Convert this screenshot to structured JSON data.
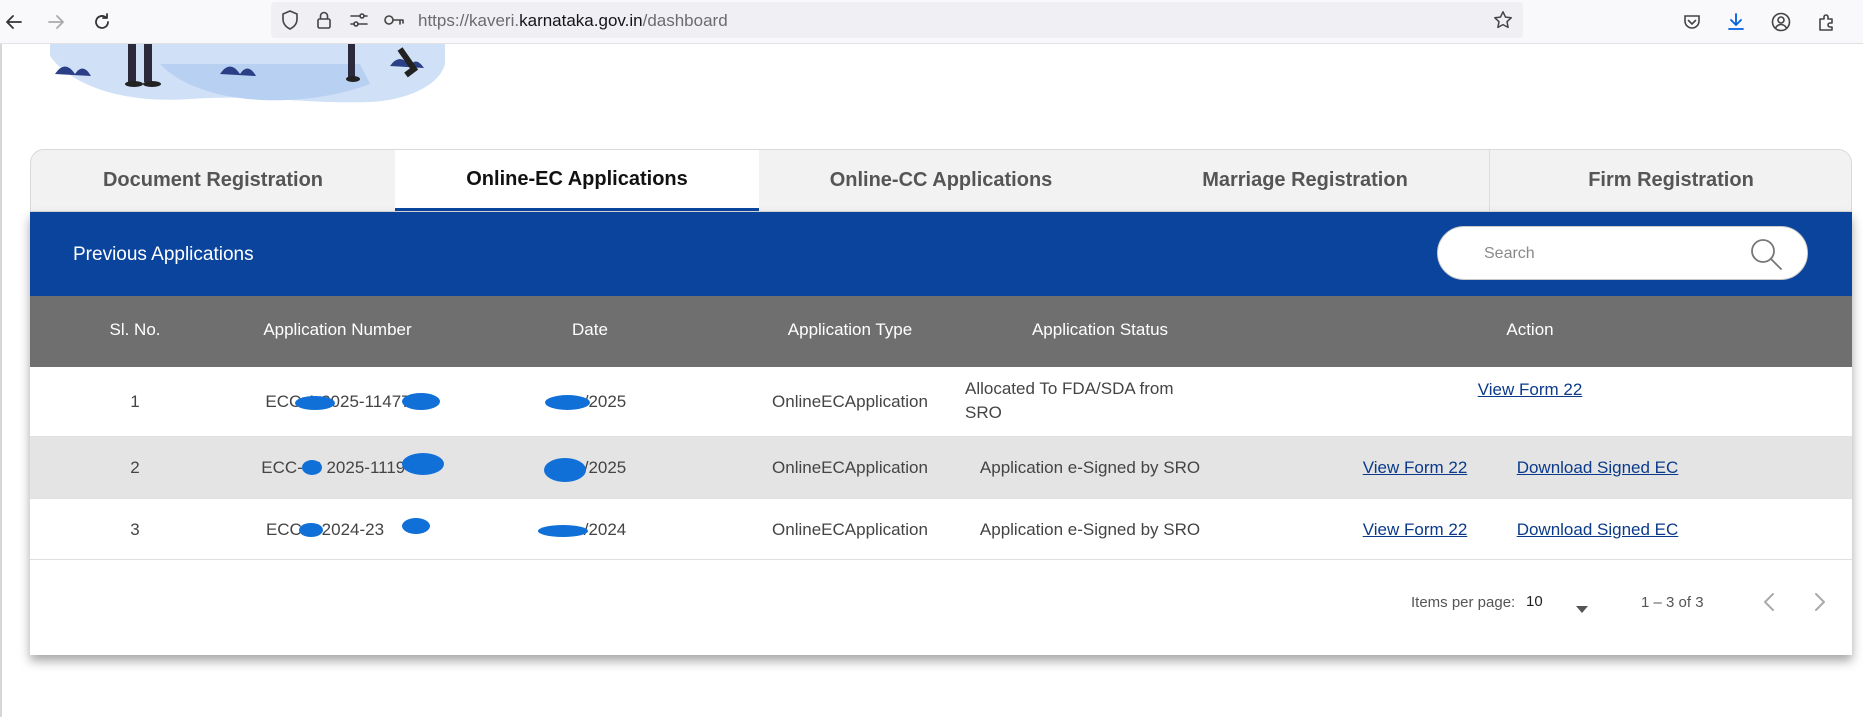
{
  "browser": {
    "url_prefix": "https://kaveri.",
    "url_domain": "karnataka.gov.in",
    "url_path": "/dashboard",
    "icons": [
      "back-arrow-icon",
      "forward-arrow-icon",
      "reload-icon",
      "shield-icon",
      "lock-icon",
      "permissions-icon",
      "key-icon",
      "star-icon",
      "pocket-icon",
      "download-icon",
      "account-icon",
      "extensions-icon"
    ]
  },
  "tabs": [
    {
      "label": "Document Registration",
      "active": false
    },
    {
      "label": "Online-EC Applications",
      "active": true
    },
    {
      "label": "Online-CC Applications",
      "active": false
    },
    {
      "label": "Marriage Registration",
      "active": false
    },
    {
      "label": "Firm Registration",
      "active": false
    }
  ],
  "panel": {
    "title": "Previous Applications",
    "search_placeholder": "Search"
  },
  "table": {
    "headers": [
      "Sl. No.",
      "Application Number",
      "Date",
      "Application Type",
      "Application Status",
      "Action"
    ],
    "rows": [
      {
        "sl": "1",
        "app_number": "ECC-1 2025-11477",
        "date": "/2025",
        "type": "OnlineECApplication",
        "status": "Allocated To FDA/SDA from SRO",
        "actions": [
          "View Form 22"
        ]
      },
      {
        "sl": "2",
        "app_number": "ECC-03 2025-11194",
        "date": "/2025",
        "type": "OnlineECApplication",
        "status": "Application e-Signed by SRO",
        "actions": [
          "View Form 22",
          "Download Signed EC"
        ]
      },
      {
        "sl": "3",
        "app_number": "ECC-1 2024-23",
        "date": "/2024",
        "type": "OnlineECApplication",
        "status": "Application e-Signed by SRO",
        "actions": [
          "View Form 22",
          "Download Signed EC"
        ]
      }
    ]
  },
  "paginator": {
    "items_per_page_label": "Items per page:",
    "items_per_page_value": "10",
    "range_label": "1 – 3 of 3"
  },
  "colors": {
    "header_blue": "#0b449c",
    "table_header_gray": "#6f6f6f",
    "link": "#0b3a8a",
    "redaction": "#1170d8"
  }
}
